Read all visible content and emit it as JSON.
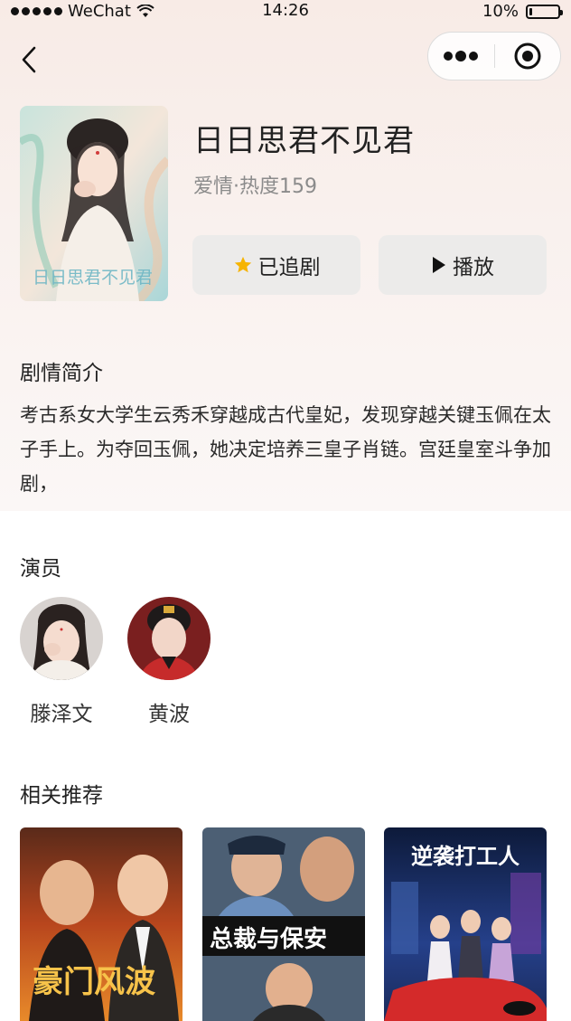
{
  "status_bar": {
    "carrier": "WeChat",
    "time": "14:26",
    "battery_text": "10%",
    "battery_level": 0.1
  },
  "nav": {
    "back_icon": "chevron-left-icon",
    "more_icon": "more-dots-icon",
    "close_icon": "target-circle-icon"
  },
  "drama": {
    "title": "日日思君不见君",
    "meta": "爱情·热度159",
    "poster_text": "日日思君不见君",
    "follow_label": "已追剧",
    "play_label": "播放",
    "accent_star": "#f6b400"
  },
  "synopsis": {
    "heading": "剧情简介",
    "text": "考古系女大学生云秀禾穿越成古代皇妃，发现穿越关键玉佩在太子手上。为夺回玉佩，她决定培养三皇子肖链。宫廷皇室斗争加剧，"
  },
  "actors": {
    "heading": "演员",
    "items": [
      {
        "name": "滕泽文"
      },
      {
        "name": "黄波"
      }
    ]
  },
  "recommend": {
    "heading": "相关推荐",
    "items": [
      {
        "poster_text": "豪门风波"
      },
      {
        "poster_text": "总裁与保安"
      },
      {
        "poster_text": "逆袭打工人"
      }
    ]
  }
}
